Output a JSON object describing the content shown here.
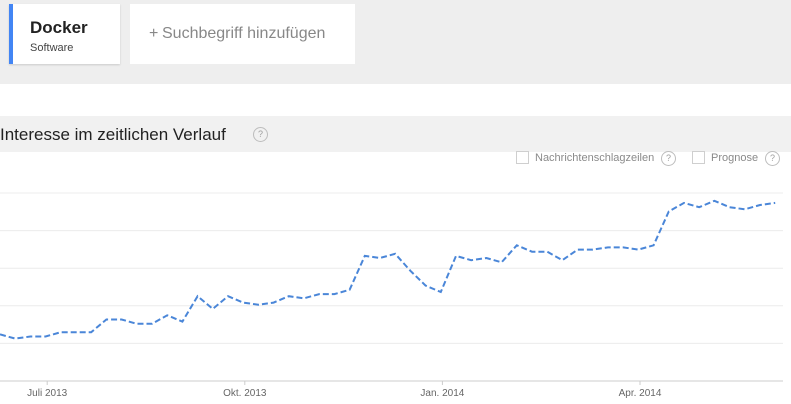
{
  "search_terms": [
    {
      "name": "Docker",
      "category": "Software",
      "color": "#4285f4"
    }
  ],
  "add_term": {
    "plus": "+",
    "label": "Suchbegriff hinzufügen"
  },
  "section": {
    "title": "Interesse im zeitlichen Verlauf",
    "help_icon": "question-circle-icon",
    "help_glyph": "?"
  },
  "options": [
    {
      "label": "Nachrichtenschlagzeilen",
      "checked": false,
      "help_glyph": "?"
    },
    {
      "label": "Prognose",
      "checked": false,
      "help_glyph": "?"
    }
  ],
  "chart_data": {
    "type": "line",
    "x_ticks": [
      "Juli 2013",
      "Okt. 2013",
      "Jan. 2014",
      "Apr. 2014"
    ],
    "x_tick_weeks": [
      1,
      14,
      27,
      40
    ],
    "ylim": [
      0,
      100
    ],
    "grid": true,
    "line_style": "dashed",
    "series": [
      {
        "color": "#4a86d8",
        "values": [
          22,
          20,
          21,
          21,
          23,
          23,
          23,
          29,
          29,
          27,
          27,
          31,
          28,
          40,
          34,
          40,
          37,
          36,
          37,
          40,
          39,
          41,
          41,
          43,
          59,
          58,
          60,
          52,
          45,
          42,
          59,
          57,
          58,
          56,
          64,
          61,
          61,
          57,
          62,
          62,
          63,
          63,
          62,
          64,
          80,
          84,
          82,
          85,
          82,
          81,
          83,
          84
        ]
      }
    ]
  }
}
